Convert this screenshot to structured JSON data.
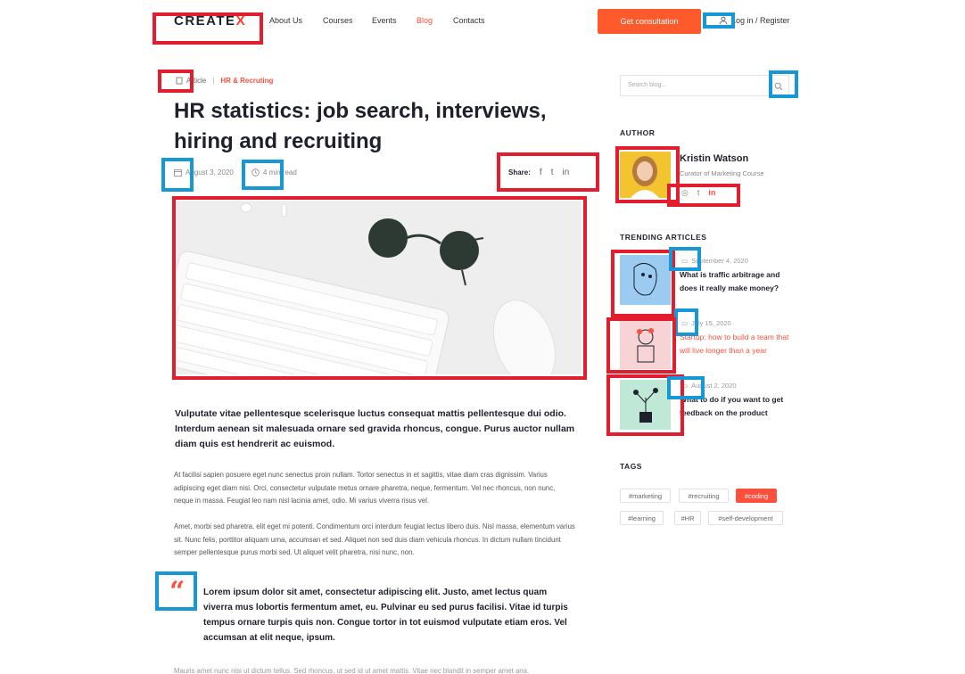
{
  "header": {
    "logo_text": "CREATE",
    "logo_mark": "X",
    "nav": [
      "About Us",
      "Courses",
      "Events",
      "Blog",
      "Contacts"
    ],
    "active_nav": "Blog",
    "cta_label": "Get consultation",
    "login_label": "Log in / Register",
    "accent": "#ff4f3d"
  },
  "breadcrumb": {
    "type": "Article",
    "category": "HR & Recruting"
  },
  "post": {
    "title": "HR statistics: job search,  interviews, hiring and recruiting",
    "date": "August 3, 2020",
    "read_time": "4 min read",
    "share_label": "Share:",
    "share_icons": [
      "f",
      "t",
      "in"
    ],
    "lead": "Vulputate vitae pellentesque scelerisque luctus consequat mattis pellentesque dui odio. Interdum aenean sit malesuada ornare sed gravida rhoncus, congue. Purus auctor nullam diam quis est hendrerit ac euismod.",
    "para1": "At facilisi sapien posuere eget nunc senectus proin nullam. Tortor senectus in et sagittis, vitae diam cras dignissim. Varius adipiscing eget diam nisi. Orci, consectetur vulputate metus ornare pharetra, neque, fermentum. Vel nec rhoncus, non nunc, neque in massa. Feugiat leo nam nisl lacinia amet, odio. Mi varius viverra risus vel.",
    "para2": "Amet, morbi sed pharetra, elit eget mi potenti. Condimentum orci interdum feugiat lectus libero duis. Nisl massa, elementum varius sit. Nunc felis, porttitor aliquam urna, accumsan et sed. Aliquet non sed duis diam vehicula rhoncus. In dictum nullam tincidunt semper pellentesque purus morbi sed. Ut aliquet velit pharetra, nisi nunc, non.",
    "quote": "Lorem ipsum dolor sit amet, consectetur adipiscing elit. Justo, amet lectus quam viverra mus lobortis fermentum amet, eu. Pulvinar eu sed purus  facilisi. Vitae id turpis tempus ornare turpis quis non. Congue tortor in tot euismod vulputate etiam eros. Vel accumsan at elit neque, ipsum.",
    "tail": "Mauris amet nunc nisi ut dictum tellus. Sed rhoncus, ut sed id ut amet mattis. Vitae nec blandit in semper amet ana."
  },
  "sidebar": {
    "search_placeholder": "Search blog...",
    "author_heading": "AUTHOR",
    "author_name": "Kristin Watson",
    "author_role": "Curator of Marketing Course",
    "trending_heading": "TRENDING ARTICLES",
    "trending": [
      {
        "date": "September 4, 2020",
        "title": "What is traffic arbitrage and does it really make money?"
      },
      {
        "date": "July 15, 2020",
        "title": "Startup: how to build a team that will live longer than a year"
      },
      {
        "date": "August 2, 2020",
        "title": "What to do if you want to get feedback on the product"
      }
    ],
    "tags_heading": "TAGS",
    "tags": [
      "#marketing",
      "#recruiting",
      "#coding",
      "#learning",
      "#HR",
      "#self-development"
    ],
    "active_tag": "#coding"
  },
  "annotation_colors": {
    "red": "#e11d2e",
    "blue": "#1698d6"
  }
}
